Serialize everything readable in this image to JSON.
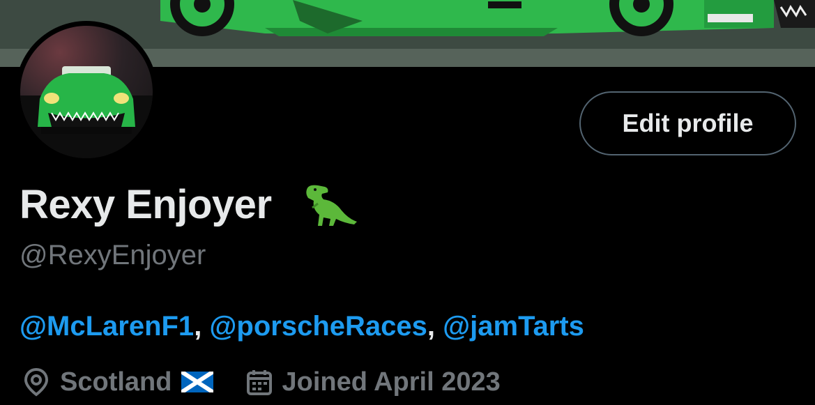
{
  "profile": {
    "display_name": "Rexy Enjoyer",
    "name_emoji": "t-rex-emoji",
    "handle": "@RexyEnjoyer",
    "edit_button_label": "Edit profile",
    "bio": {
      "mentions": [
        "@McLarenF1",
        "@porscheRaces",
        "@jamTarts"
      ],
      "separator": ", "
    },
    "location": "Scotland",
    "location_flag": "scotland-flag",
    "joined": "Joined April 2023"
  },
  "icons": {
    "location": "location-pin-icon",
    "calendar": "calendar-icon"
  },
  "colors": {
    "background": "#000000",
    "text_primary": "#e7e9ea",
    "text_secondary": "#71767b",
    "link": "#1d9bf0",
    "button_border": "#536471",
    "car_green": "#27b548"
  }
}
